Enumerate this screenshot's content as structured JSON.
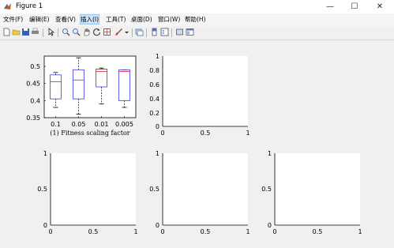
{
  "window": {
    "title": "Figure 1",
    "controls": [
      "—",
      "☐",
      "✕"
    ]
  },
  "menu": [
    {
      "label": "文件(F)"
    },
    {
      "label": "编辑(E)"
    },
    {
      "label": "查看(V)"
    },
    {
      "label": "插入(I)",
      "active": true
    },
    {
      "label": "工具(T)"
    },
    {
      "label": "桌面(D)"
    },
    {
      "label": "窗口(W)"
    },
    {
      "label": "帮助(H)"
    }
  ],
  "toolbar": {
    "icons": [
      "new-figure-icon",
      "open-file-icon",
      "save-icon",
      "print-icon",
      "pointer-icon",
      "zoom-in-icon",
      "zoom-out-icon",
      "pan-icon",
      "rotate-icon",
      "data-cursor-icon",
      "brush-icon",
      "link-icon",
      "colorbar-icon",
      "legend-icon",
      "hide-plot-tools-icon",
      "show-plot-tools-icon"
    ]
  },
  "colors": {
    "box": "#3a3af0",
    "median": "#e8333b",
    "whisker": "#000000",
    "axis": "#000000"
  },
  "chart_data": [
    {
      "type": "box",
      "categories": [
        "0.1",
        "0.05",
        "0.01",
        "0.005"
      ],
      "boxes": [
        {
          "whisker_low": 0.38,
          "q1": 0.405,
          "median": 0.455,
          "q3": 0.475,
          "whisker_high": 0.482
        },
        {
          "whisker_low": 0.36,
          "q1": 0.405,
          "median": 0.46,
          "q3": 0.49,
          "whisker_high": 0.525
        },
        {
          "whisker_low": 0.39,
          "q1": 0.44,
          "median": 0.485,
          "q3": 0.492,
          "whisker_high": 0.495
        },
        {
          "whisker_low": 0.38,
          "q1": 0.4,
          "median": 0.485,
          "q3": 0.49,
          "whisker_high": 0.49
        }
      ],
      "ylim": [
        0.35,
        0.53
      ],
      "yticks": [
        "0.35",
        "0.4",
        "0.45",
        "0.5"
      ],
      "xlabel": "(1) Fitness scaling factor"
    },
    {
      "type": "empty",
      "xlim": [
        0,
        1
      ],
      "ylim": [
        0,
        1
      ],
      "xticks": [
        "0",
        "0.5",
        "1"
      ],
      "yticks": [
        "0",
        "0.2",
        "0.4",
        "0.6",
        "0.8",
        "1"
      ]
    },
    {
      "type": "empty",
      "xlim": [
        0,
        1
      ],
      "ylim": [
        0,
        1
      ],
      "xticks": [
        "0",
        "0.5",
        "1"
      ],
      "yticks": [
        "0",
        "0.5",
        "1"
      ]
    },
    {
      "type": "empty",
      "xlim": [
        0,
        1
      ],
      "ylim": [
        0,
        1
      ],
      "xticks": [
        "0",
        "0.5",
        "1"
      ],
      "yticks": [
        "0",
        "0.5",
        "1"
      ]
    },
    {
      "type": "empty",
      "xlim": [
        0,
        1
      ],
      "ylim": [
        0,
        1
      ],
      "xticks": [
        "0",
        "0.5",
        "1"
      ],
      "yticks": [
        "0",
        "0.5",
        "1"
      ]
    }
  ]
}
